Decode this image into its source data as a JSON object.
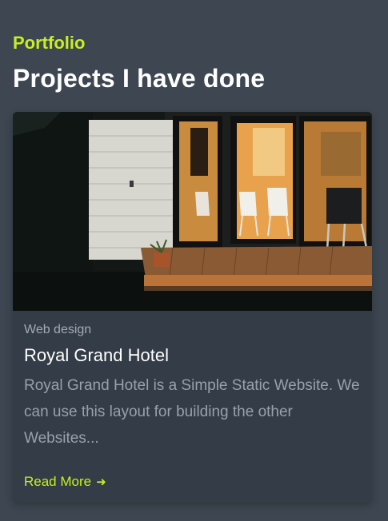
{
  "section": {
    "eyebrow": "Portfolio",
    "heading": "Projects I have done"
  },
  "card": {
    "category": "Web design",
    "title": "Royal Grand Hotel",
    "description": "Royal Grand Hotel is a Simple Static Website. We can use this layout for building the other Websites...",
    "read_more_label": "Read More",
    "read_more_icon": "arrow-right-icon"
  },
  "colors": {
    "background": "#3d4651",
    "card": "#333c47",
    "accent": "#c6f01e"
  }
}
